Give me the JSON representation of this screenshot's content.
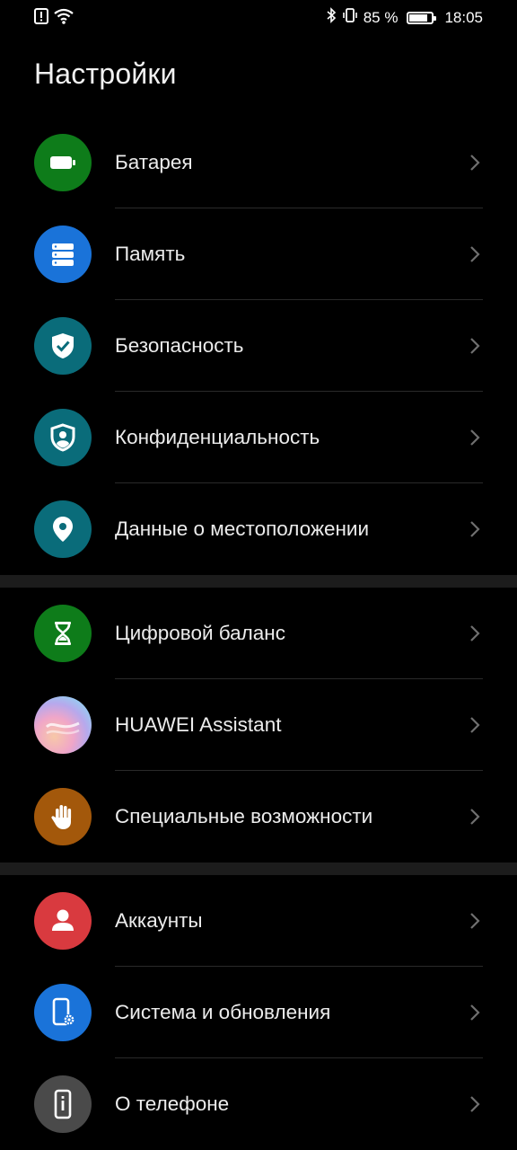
{
  "status_bar": {
    "battery_percent": "85 %",
    "battery_level": 0.85,
    "time": "18:05",
    "icons": [
      "alert-icon",
      "wifi-icon",
      "bluetooth-icon",
      "vibrate-icon",
      "battery-icon"
    ]
  },
  "header": {
    "title": "Настройки"
  },
  "sections": [
    {
      "items": [
        {
          "label": "Батарея",
          "icon": "battery-icon",
          "color": "#0e7c1a"
        },
        {
          "label": "Память",
          "icon": "storage-icon",
          "color": "#1a73d9"
        },
        {
          "label": "Безопасность",
          "icon": "shield-check-icon",
          "color": "#0a6c7a"
        },
        {
          "label": "Конфиденциальность",
          "icon": "privacy-shield-icon",
          "color": "#0a6c7a"
        },
        {
          "label": "Данные о местоположении",
          "icon": "location-pin-icon",
          "color": "#0a6c7a"
        }
      ]
    },
    {
      "items": [
        {
          "label": "Цифровой баланс",
          "icon": "hourglass-icon",
          "color": "#0e7c1a"
        },
        {
          "label": "HUAWEI Assistant",
          "icon": "assistant-icon",
          "color": "gradient"
        },
        {
          "label": "Специальные возможности",
          "icon": "hand-icon",
          "color": "#a3580b"
        }
      ]
    },
    {
      "items": [
        {
          "label": "Аккаунты",
          "icon": "user-icon",
          "color": "#d93a3f"
        },
        {
          "label": "Система и обновления",
          "icon": "phone-settings-icon",
          "color": "#1a73d9"
        },
        {
          "label": "О телефоне",
          "icon": "phone-info-icon",
          "color": "#4a4a4a"
        }
      ]
    }
  ]
}
